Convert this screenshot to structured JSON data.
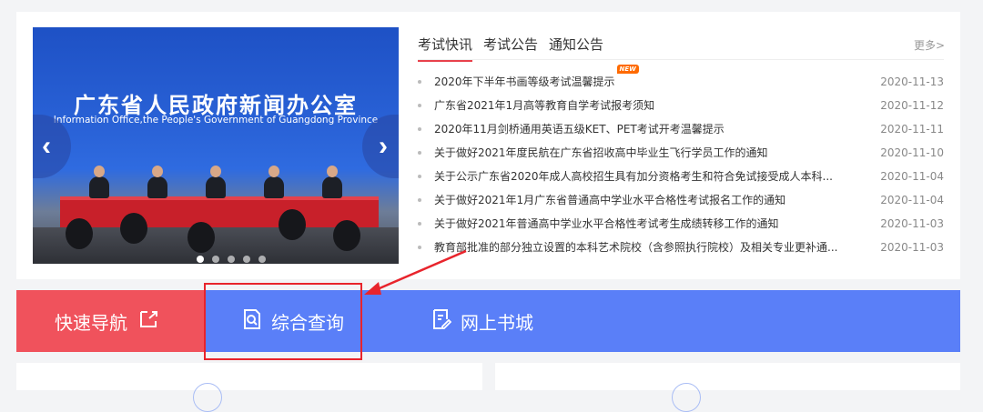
{
  "banner": {
    "title": "广东省人民政府新闻办公室",
    "subtitle": "Information Office,the People's Government of Guangdong Province",
    "prev_label": "‹",
    "next_label": "›",
    "slide_count": 5,
    "active_slide": 0
  },
  "news": {
    "tabs": [
      {
        "label": "考试快讯",
        "active": true
      },
      {
        "label": "考试公告",
        "active": false
      },
      {
        "label": "通知公告",
        "active": false
      }
    ],
    "more_label": "更多>",
    "new_badge": "NEW",
    "items": [
      {
        "title": "2020年下半年书画等级考试温馨提示",
        "date": "2020-11-13",
        "is_new": true
      },
      {
        "title": "广东省2021年1月高等教育自学考试报考须知",
        "date": "2020-11-12",
        "is_new": false
      },
      {
        "title": "2020年11月剑桥通用英语五级KET、PET考试开考温馨提示",
        "date": "2020-11-11",
        "is_new": false
      },
      {
        "title": "关于做好2021年度民航在广东省招收高中毕业生飞行学员工作的通知",
        "date": "2020-11-10",
        "is_new": false
      },
      {
        "title": "关于公示广东省2020年成人高校招生具有加分资格考生和符合免试接受成人本科...",
        "date": "2020-11-04",
        "is_new": false
      },
      {
        "title": "关于做好2021年1月广东省普通高中学业水平合格性考试报名工作的通知",
        "date": "2020-11-04",
        "is_new": false
      },
      {
        "title": "关于做好2021年普通高中学业水平合格性考试考生成绩转移工作的通知",
        "date": "2020-11-03",
        "is_new": false
      },
      {
        "title": "教育部批准的部分独立设置的本科艺术院校（含参照执行院校）及相关专业更补通...",
        "date": "2020-11-03",
        "is_new": false
      }
    ]
  },
  "quick_nav": {
    "label": "快速导航",
    "label_icon": "external-link-icon",
    "links": [
      {
        "label": "综合查询",
        "icon": "search-doc-icon"
      },
      {
        "label": "网上书城",
        "icon": "edit-doc-icon"
      }
    ]
  },
  "colors": {
    "accent_red": "#f0525c",
    "nav_blue": "#5a7ff8",
    "annotation_red": "#e8242c",
    "badge_orange": "#ff6a00"
  }
}
